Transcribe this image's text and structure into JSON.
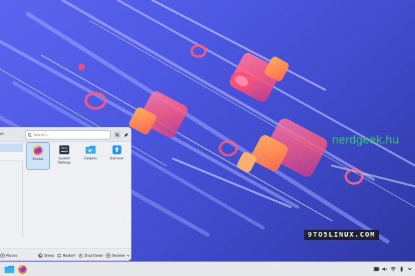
{
  "watermarks": {
    "nerdgeek": "nerdgeek.hu",
    "nine_to_five": "9TO5LINUX.COM"
  },
  "launcher": {
    "header_cut_label": "er",
    "search_placeholder": "Search...",
    "apps": [
      {
        "label": "Firefox",
        "icon": "firefox-icon",
        "selected": true
      },
      {
        "label": "System Settings",
        "icon": "system-settings-icon",
        "selected": false
      },
      {
        "label": "Dolphin",
        "icon": "dolphin-folder-icon",
        "selected": false
      },
      {
        "label": "Discover",
        "icon": "discover-icon",
        "selected": false
      }
    ],
    "footer": {
      "places": "Places",
      "sleep": "Sleep",
      "restart": "Restart",
      "shutdown": "Shut Down",
      "session": "Session"
    }
  },
  "taskbar": {
    "pinned": [
      "dolphin-icon",
      "firefox-icon"
    ],
    "tray": [
      "battery-icon",
      "volume-icon",
      "network-icon",
      "bluetooth-icon",
      "show-desktop-icon"
    ]
  },
  "colors": {
    "wallpaper_top": "#5b64ee",
    "wallpaper_bottom": "#2e369f",
    "accent_selection": "#cfe3f7",
    "watermark_green": "#35c96f"
  }
}
